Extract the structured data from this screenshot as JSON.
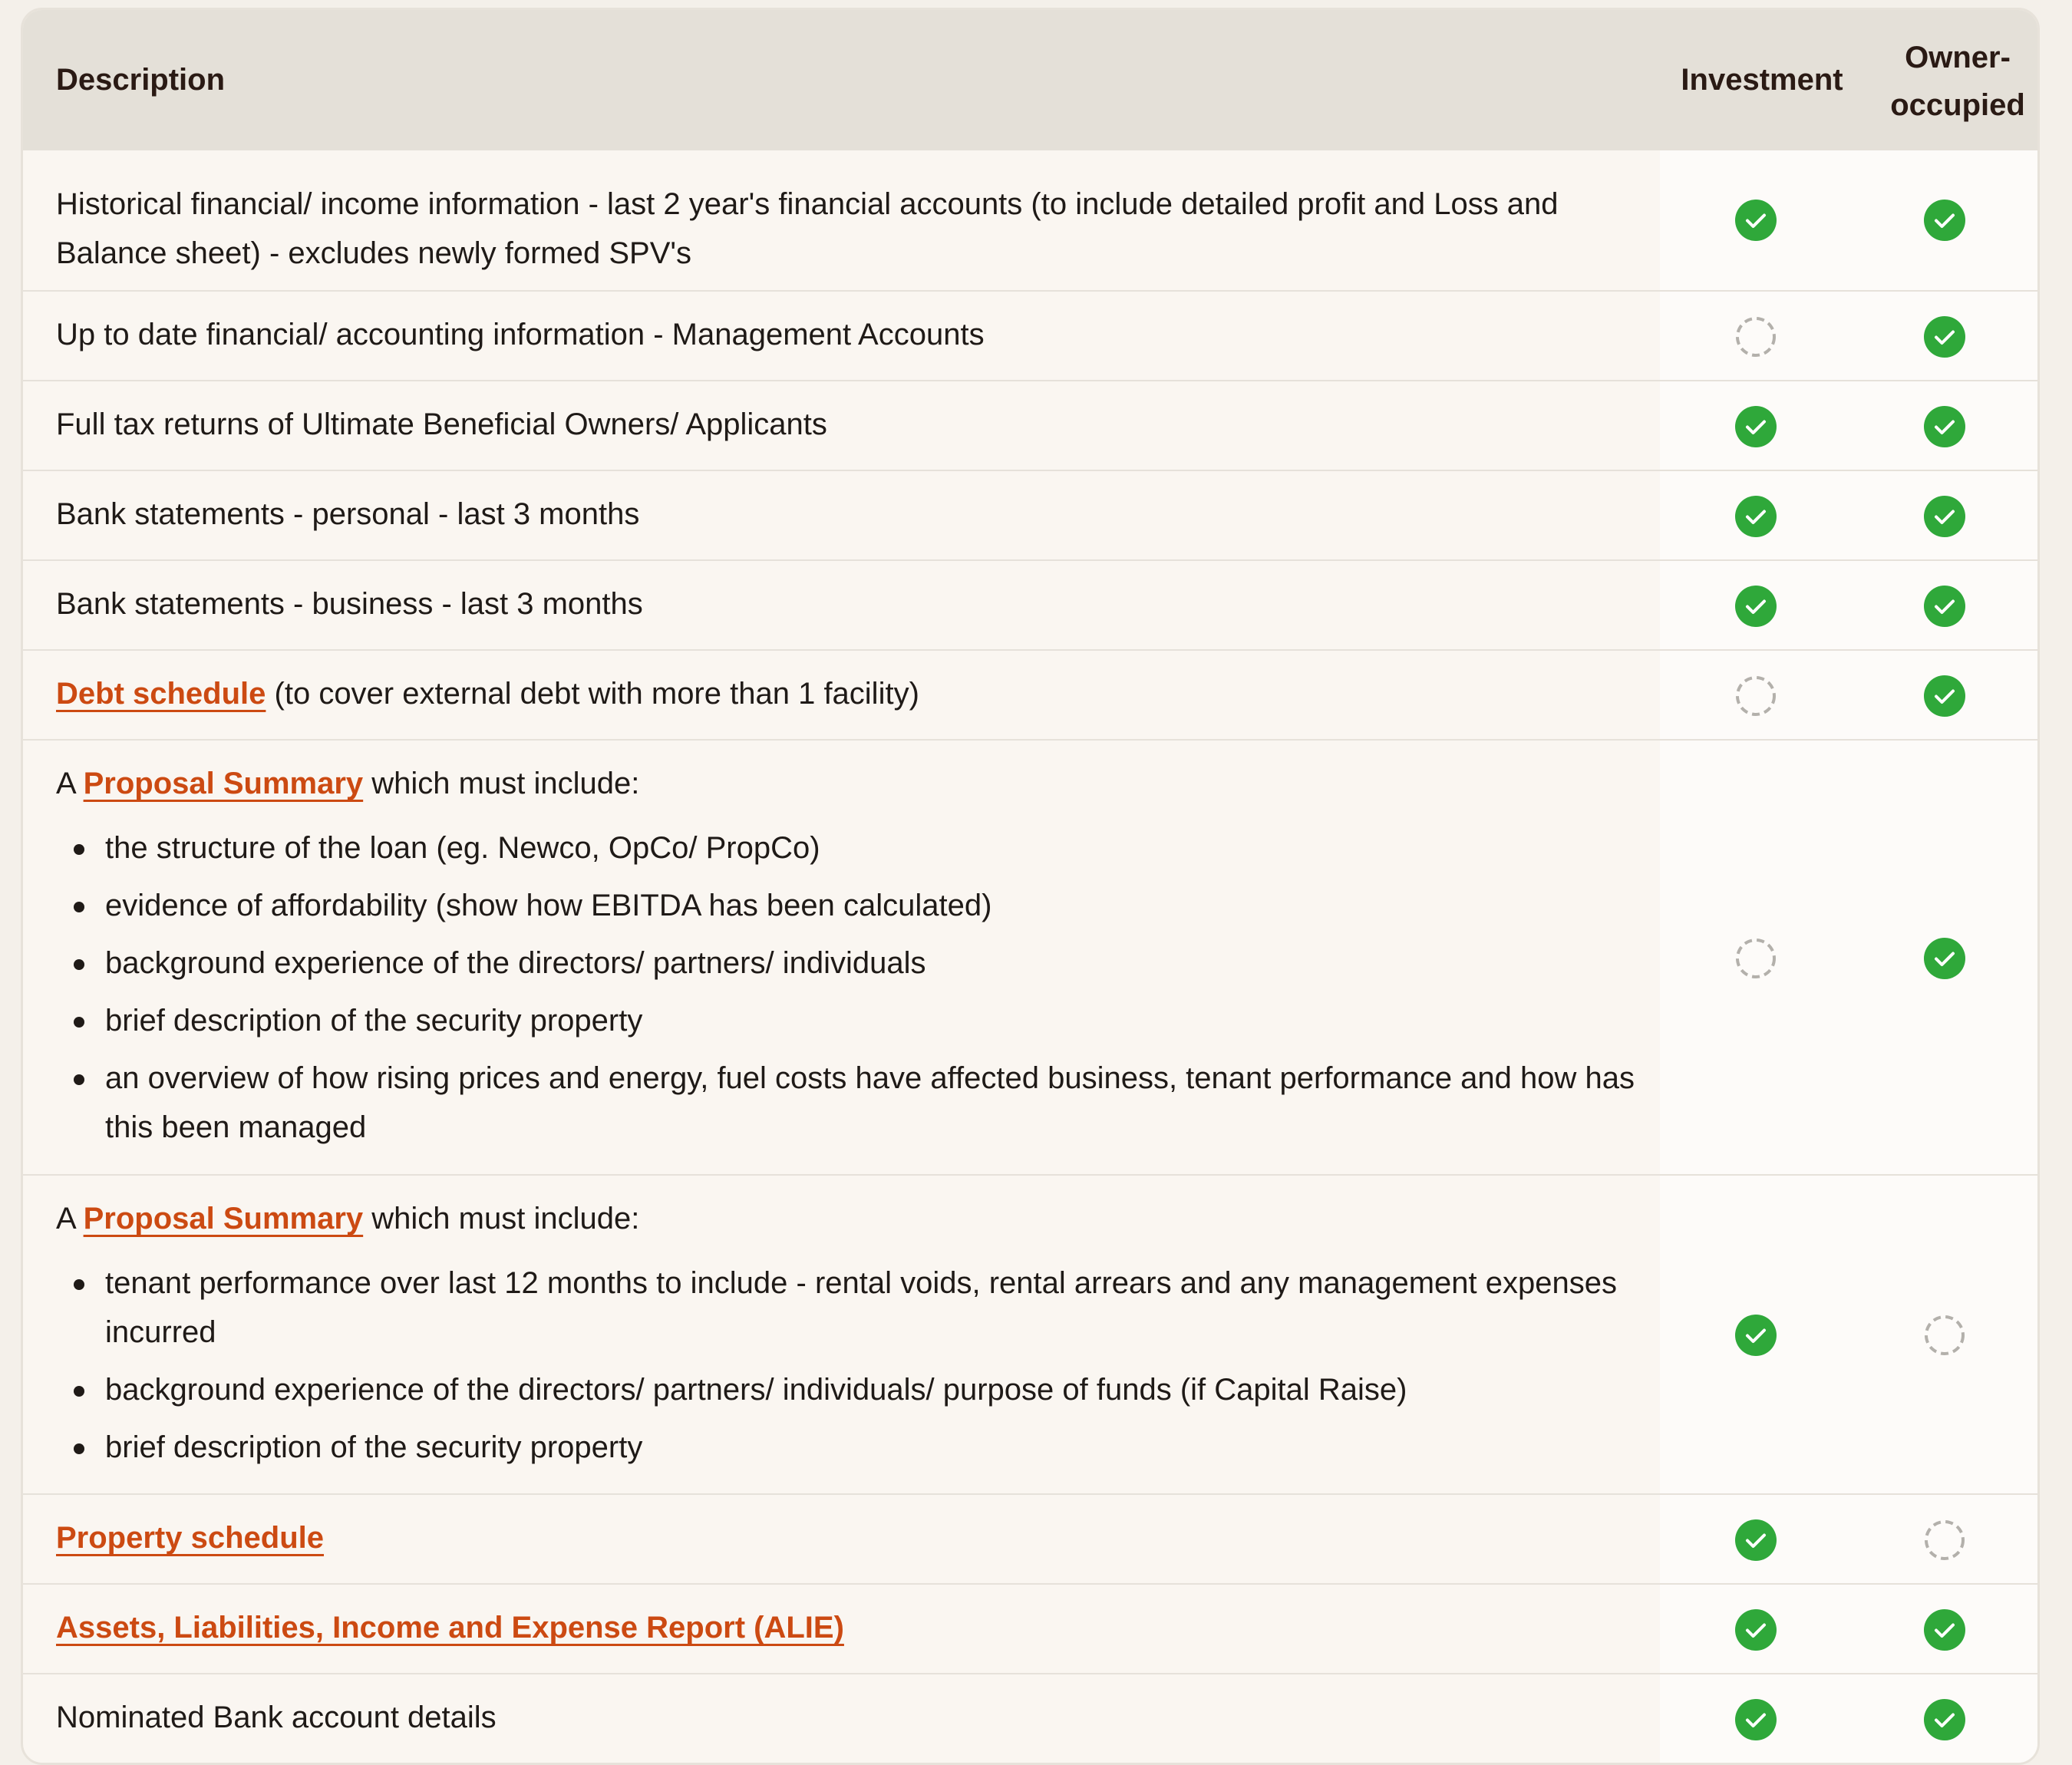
{
  "header": {
    "description": "Description",
    "investment": "Investment",
    "owner_occupied": "Owner-occupied"
  },
  "rows": [
    {
      "text": "Historical financial/ income information - last 2 year's financial accounts (to include detailed profit and Loss and Balance sheet) - excludes newly formed SPV's",
      "investment": "required",
      "owner_occupied": "required"
    },
    {
      "text": "Up to date financial/ accounting information - Management Accounts",
      "investment": "not-required",
      "owner_occupied": "required"
    },
    {
      "text": "Full tax returns of Ultimate Beneficial Owners/ Applicants",
      "investment": "required",
      "owner_occupied": "required"
    },
    {
      "text": "Bank statements - personal - last 3 months",
      "investment": "required",
      "owner_occupied": "required"
    },
    {
      "text": "Bank statements - business - last 3 months",
      "investment": "required",
      "owner_occupied": "required"
    },
    {
      "link": "Debt schedule",
      "text": " (to cover external debt with more than 1 facility)",
      "investment": "not-required",
      "owner_occupied": "required"
    },
    {
      "prefix": "A ",
      "link": "Proposal Summary",
      "text": " which must include:",
      "bullets": [
        "the structure of the loan (eg. Newco, OpCo/ PropCo)",
        "evidence of affordability (show how EBITDA has been calculated)",
        "background experience of the directors/ partners/ individuals",
        "brief description of the security property",
        "an overview of how rising prices and energy, fuel costs have affected business, tenant performance and how has this been managed"
      ],
      "investment": "not-required",
      "owner_occupied": "required"
    },
    {
      "prefix": "A ",
      "link": "Proposal Summary",
      "text": " which must include:",
      "bullets": [
        "tenant performance over last 12 months to include - rental voids, rental arrears and any management expenses incurred",
        "background experience of the directors/ partners/ individuals/ purpose of funds (if Capital Raise)",
        "brief description of the security property"
      ],
      "investment": "required",
      "owner_occupied": "not-required"
    },
    {
      "link": "Property schedule",
      "investment": "required",
      "owner_occupied": "not-required"
    },
    {
      "link": "Assets, Liabilities, Income and Expense Report (ALIE)",
      "investment": "required",
      "owner_occupied": "required"
    },
    {
      "text": "Nominated Bank account details",
      "investment": "required",
      "owner_occupied": "required"
    }
  ],
  "icons": {
    "required": "check-circle-icon",
    "not-required": "dashed-circle-icon"
  },
  "colors": {
    "check": "#2fa83a",
    "dashed": "#b3b0ab",
    "link": "#cc4a12",
    "header_bg": "#e4e0d8"
  }
}
